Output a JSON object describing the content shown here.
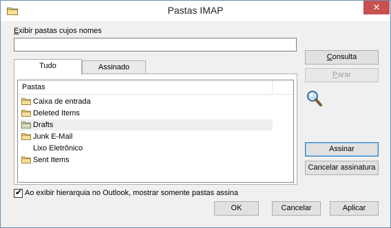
{
  "window": {
    "title": "Pastas IMAP",
    "close_glyph": "✕",
    "close_color": "#c75050"
  },
  "filter": {
    "label_prefix": "",
    "label_mnemonic": "E",
    "label_rest": "xibir pastas cujos nomes",
    "value": "",
    "placeholder": ""
  },
  "tabs": [
    {
      "label": "Tudo",
      "active": true
    },
    {
      "label": "Assinado",
      "active": false
    }
  ],
  "list": {
    "column_header": "Pastas",
    "folders": [
      {
        "name": "Caixa de entrada",
        "icon": "folder-icon",
        "selected": false
      },
      {
        "name": "Deleted Items",
        "icon": "folder-icon",
        "selected": false
      },
      {
        "name": "Drafts",
        "icon": "folder-icon",
        "selected": true
      },
      {
        "name": "Junk E-Mail",
        "icon": "folder-icon",
        "selected": false
      },
      {
        "name": "Lixo Eletrônico",
        "icon": "",
        "selected": false
      },
      {
        "name": "Sent Items",
        "icon": "folder-icon",
        "selected": false
      }
    ]
  },
  "side_buttons": {
    "consulta": "Consulta",
    "parar": "Parar",
    "assinar": "Assinar",
    "cancelar_assinatura": "Cancelar assinatura"
  },
  "icons": {
    "search": "magnifier-icon",
    "folder": "folder-icon"
  },
  "option": {
    "checked": true,
    "check_glyph": "✔",
    "label": "Ao exibir hierarquia no Outlook, mostrar somente pastas assina"
  },
  "footer_buttons": {
    "ok": "OK",
    "cancel": "Cancelar",
    "apply": "Aplicar"
  }
}
